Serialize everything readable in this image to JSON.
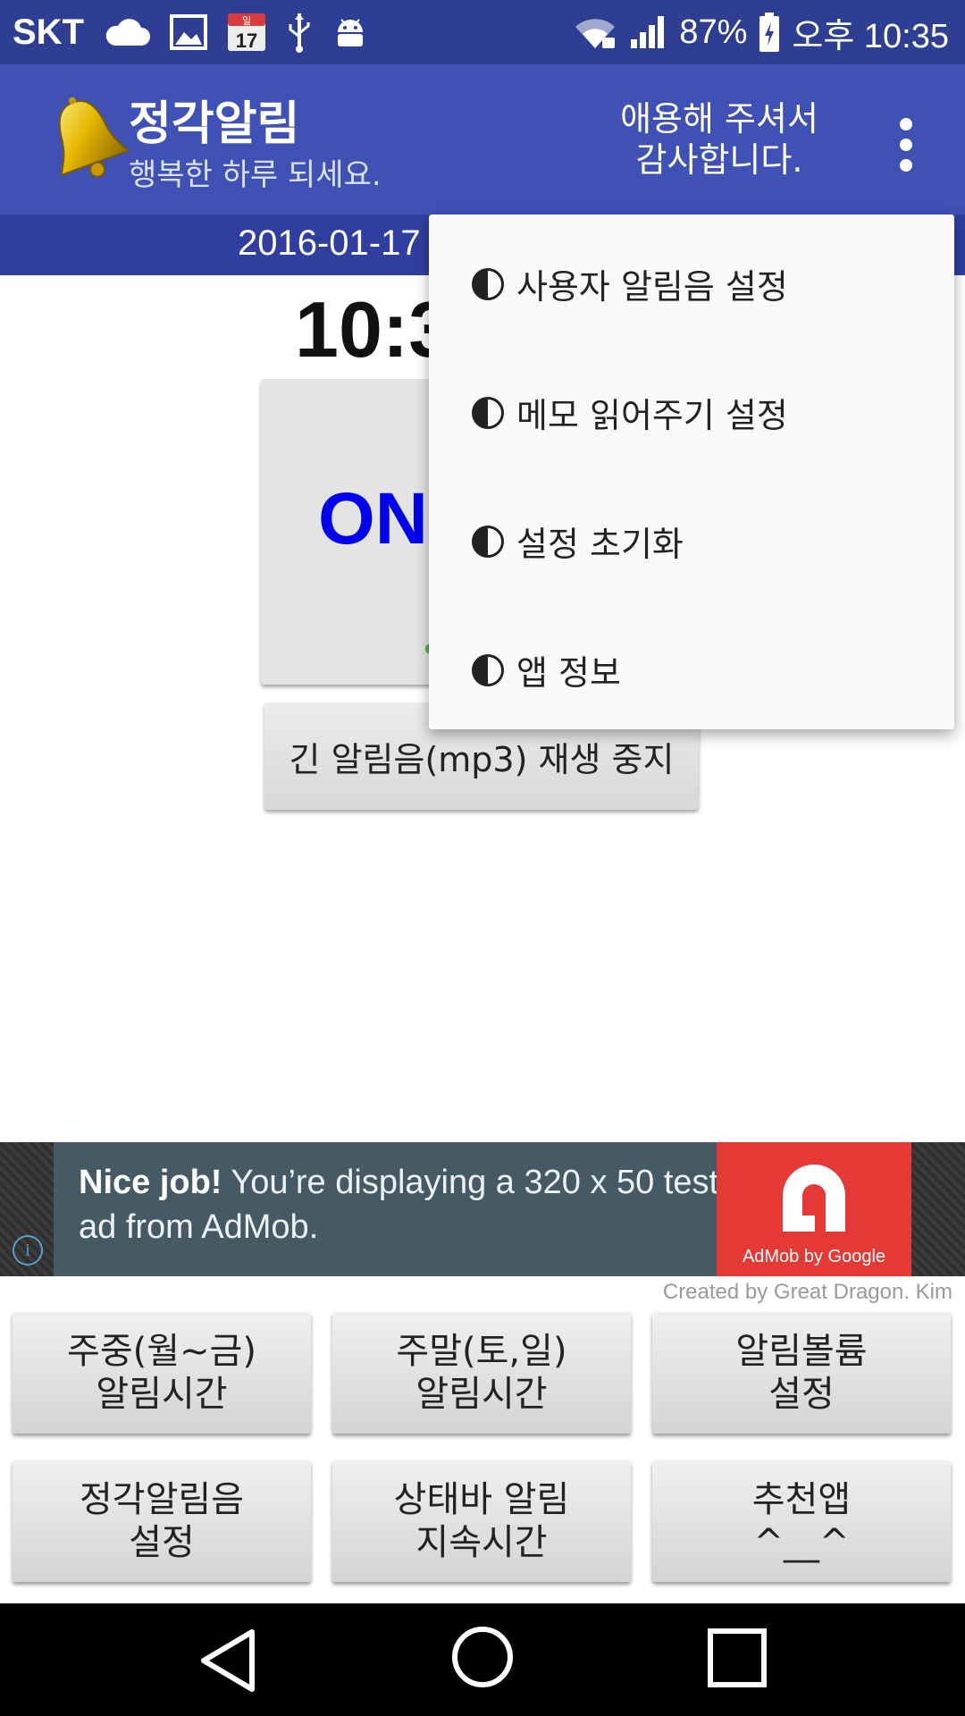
{
  "status_bar": {
    "carrier": "SKT",
    "calendar_day": "17",
    "calendar_label": "일",
    "battery": "87%",
    "time": "오후 10:35",
    "icons": [
      "cloud-icon",
      "image-icon",
      "calendar-icon",
      "usb-icon",
      "android-debug-icon",
      "wifi-icon",
      "signal-icon",
      "battery-charging-icon"
    ]
  },
  "app_bar": {
    "title": "정각알림",
    "subtitle": "행복한 하루 되세요.",
    "thanks_line1": "애용해 주셔서",
    "thanks_line2": "감사합니다."
  },
  "date_bar": {
    "date": "2016-01-17"
  },
  "main": {
    "time_partial": "10:3",
    "toggle_label": "ON",
    "stop_button": "긴 알림음(mp3) 재생 중지"
  },
  "menu": {
    "items": [
      {
        "label": "사용자 알림음 설정"
      },
      {
        "label": "메모 읽어주기 설정"
      },
      {
        "label": "설정 초기화"
      },
      {
        "label": "앱 정보"
      }
    ]
  },
  "ad": {
    "bold": "Nice job!",
    "text": " You’re displaying a 320 x 50 test ad from AdMob.",
    "logo_label": "AdMob by Google",
    "info": "i"
  },
  "credit": "Created by Great Dragon. Kim",
  "buttons": [
    {
      "line1": "주중(월~금)",
      "line2": "알림시간"
    },
    {
      "line1": "주말(토,일)",
      "line2": "알림시간"
    },
    {
      "line1": "알림볼륨",
      "line2": "설정"
    },
    {
      "line1": "정각알림음",
      "line2": "설정"
    },
    {
      "line1": "상태바 알림",
      "line2": "지속시간"
    },
    {
      "line1": "추천앱",
      "line2": "^__^"
    }
  ],
  "colors": {
    "status_bar": "#2e3e93",
    "app_bar": "#3f51b5",
    "date_bar": "#303f9f",
    "on_label": "#0000ee",
    "ad_background": "#455a64",
    "ad_logo": "#e53935"
  }
}
